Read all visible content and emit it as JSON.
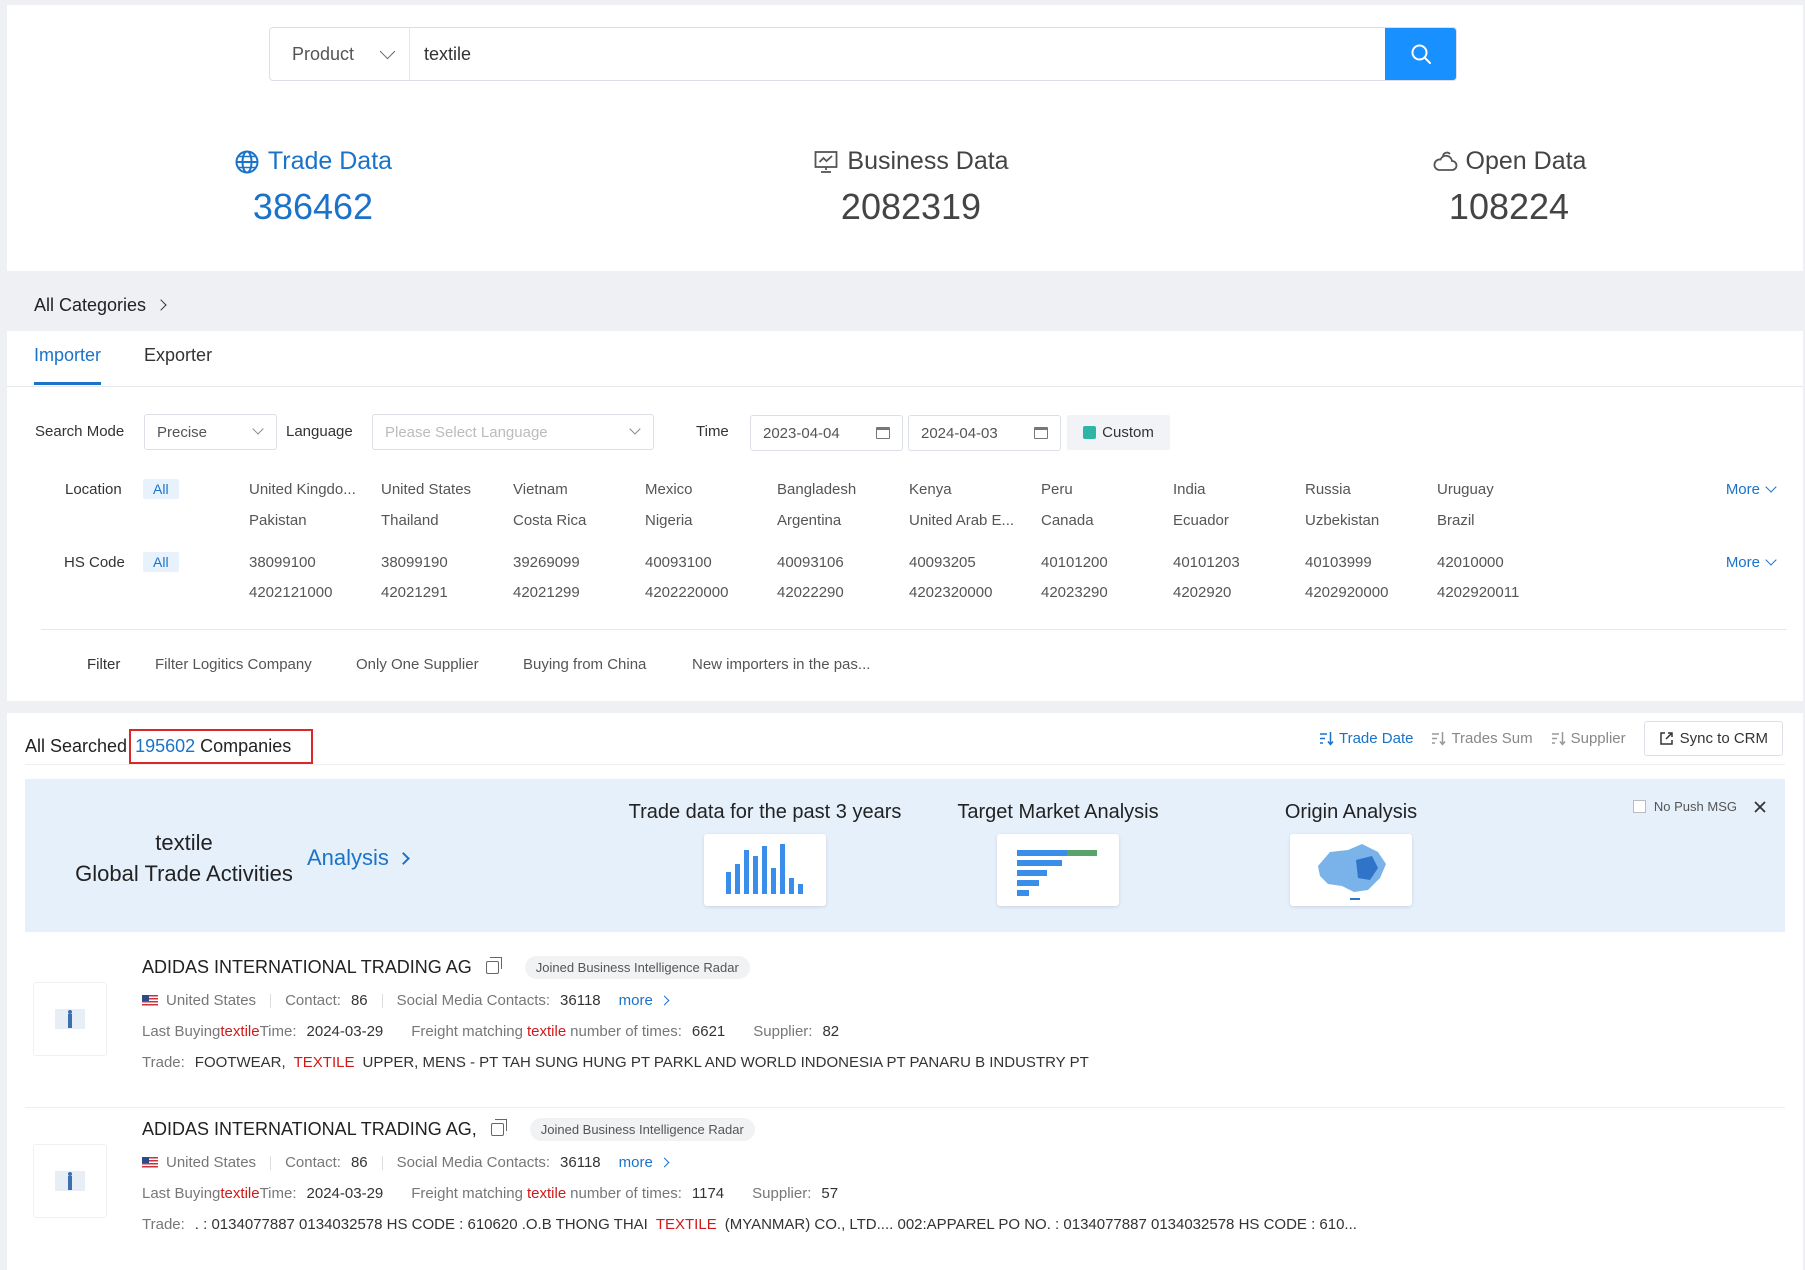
{
  "search": {
    "type": "Product",
    "query": "textile"
  },
  "stats": [
    {
      "label": "Trade Data",
      "value": "386462",
      "icon": "globe-icon"
    },
    {
      "label": "Business Data",
      "value": "2082319",
      "icon": "presentation-icon"
    },
    {
      "label": "Open Data",
      "value": "108224",
      "icon": "cloud-icon"
    }
  ],
  "categories": "All Categories",
  "tabs": [
    "Importer",
    "Exporter"
  ],
  "filters": {
    "search_mode_label": "Search Mode",
    "search_mode_value": "Precise",
    "language_label": "Language",
    "language_placeholder": "Please Select Language",
    "time_label": "Time",
    "date_from": "2023-04-04",
    "date_to": "2024-04-03",
    "custom": "Custom",
    "location_label": "Location",
    "hs_label": "HS Code",
    "all": "All",
    "more": "More",
    "locations": [
      "United Kingdo...",
      "United States",
      "Vietnam",
      "Mexico",
      "Bangladesh",
      "Kenya",
      "Peru",
      "India",
      "Russia",
      "Uruguay",
      "Pakistan",
      "Thailand",
      "Costa Rica",
      "Nigeria",
      "Argentina",
      "United Arab E...",
      "Canada",
      "Ecuador",
      "Uzbekistan",
      "Brazil"
    ],
    "hs_codes": [
      "38099100",
      "38099190",
      "39269099",
      "40093100",
      "40093106",
      "40093205",
      "40101200",
      "40101203",
      "40103999",
      "42010000",
      "4202121000",
      "42021291",
      "42021299",
      "4202220000",
      "42022290",
      "4202320000",
      "42023290",
      "4202920",
      "4202920000",
      "4202920011"
    ],
    "filter_label": "Filter",
    "filter_options": [
      "Filter Logitics Company",
      "Only One Supplier",
      "Buying from China",
      "New importers in the pas..."
    ]
  },
  "results": {
    "prefix": "All Searched",
    "count": "195602",
    "suffix": "Companies",
    "sorts": [
      "Trade Date",
      "Trades Sum",
      "Supplier"
    ],
    "sync": "Sync to CRM"
  },
  "banner": {
    "keyword": "textile",
    "subtitle": "Global Trade Activities",
    "analysis": "Analysis",
    "cards": [
      "Trade data for the past 3 years",
      "Target Market Analysis",
      "Origin Analysis"
    ],
    "no_push": "No Push MSG"
  },
  "companies": [
    {
      "name": "ADIDAS INTERNATIONAL TRADING AG",
      "badge": "Joined Business Intelligence Radar",
      "country": "United States",
      "contact_label": "Contact:",
      "contact": "86",
      "social_label": "Social Media Contacts:",
      "social": "36118",
      "more": "more",
      "last_buying_pre": "Last Buying",
      "kw": "textile",
      "last_buying_post": "Time:",
      "last_buying_date": "2024-03-29",
      "freight_pre": "Freight matching",
      "freight_post": "number of times:",
      "freight": "6621",
      "supplier_label": "Supplier:",
      "supplier": "82",
      "trade_label": "Trade:",
      "trade_pre": "FOOTWEAR,",
      "trade_kw": "TEXTILE",
      "trade_post": "UPPER, MENS - PT TAH SUNG HUNG PT PARKL AND WORLD INDONESIA PT PANARU B INDUSTRY PT"
    },
    {
      "name": "ADIDAS INTERNATIONAL TRADING AG,",
      "badge": "Joined Business Intelligence Radar",
      "country": "United States",
      "contact_label": "Contact:",
      "contact": "86",
      "social_label": "Social Media Contacts:",
      "social": "36118",
      "more": "more",
      "last_buying_pre": "Last Buying",
      "kw": "textile",
      "last_buying_post": "Time:",
      "last_buying_date": "2024-03-29",
      "freight_pre": "Freight matching",
      "freight_post": "number of times:",
      "freight": "1174",
      "supplier_label": "Supplier:",
      "supplier": "57",
      "trade_label": "Trade:",
      "trade_pre": ". : 0134077887 0134032578 HS CODE : 610620 .O.B THONG THAI",
      "trade_kw": "TEXTILE",
      "trade_post": "(MYANMAR) CO., LTD.... 002:APPAREL PO NO. : 0134077887 0134032578 HS CODE : 610..."
    }
  ],
  "colors": {
    "accent": "#1a73c8",
    "button": "#1890ff",
    "keyword": "#d0191a",
    "highlight_box": "#d92828"
  }
}
